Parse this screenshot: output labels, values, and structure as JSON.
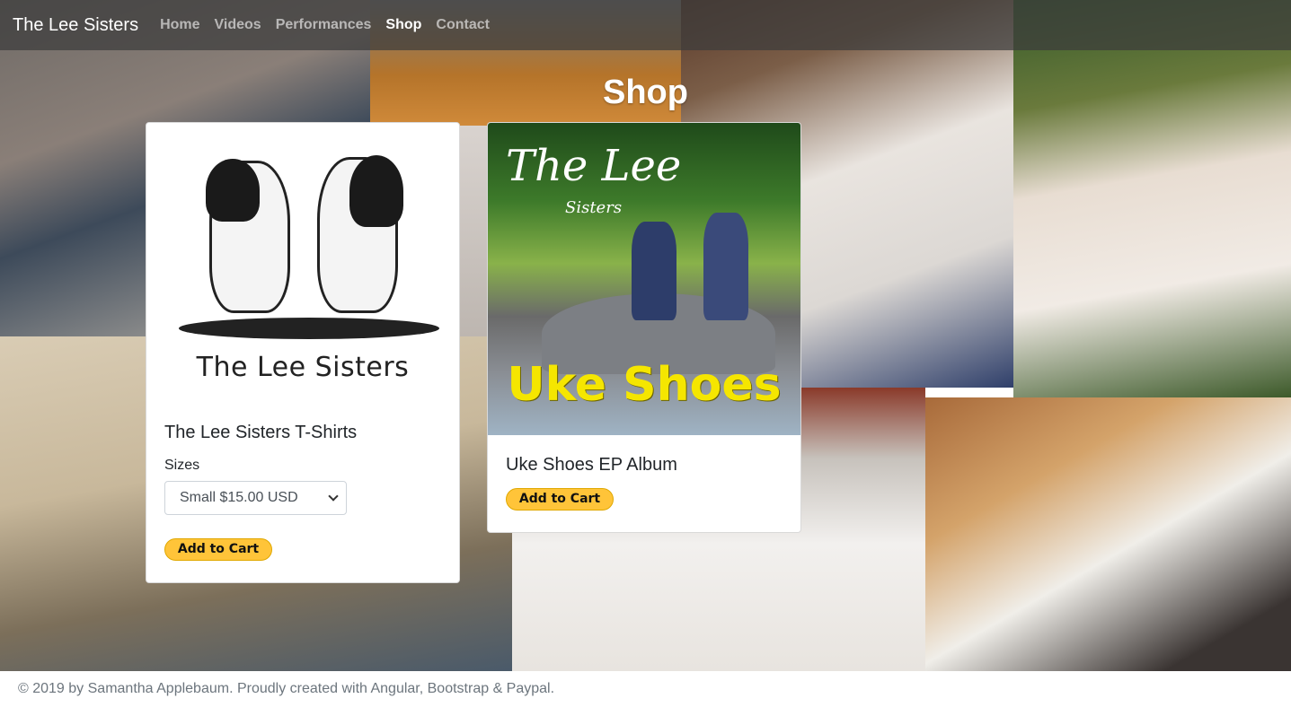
{
  "navbar": {
    "brand": "The Lee Sisters",
    "links": [
      "Home",
      "Videos",
      "Performances",
      "Shop",
      "Contact"
    ],
    "active": "Shop"
  },
  "page": {
    "title": "Shop"
  },
  "products": [
    {
      "image_text": "The Lee Sisters",
      "title": "The Lee Sisters T-Shirts",
      "size_label": "Sizes",
      "size_selected": "Small $15.00 USD",
      "button": "Add to Cart"
    },
    {
      "image_title_big": "The Lee",
      "image_title_small": "Sisters",
      "image_album": "Uke Shoes",
      "title": "Uke Shoes EP Album",
      "button": "Add to Cart"
    }
  ],
  "footer": {
    "text": "© 2019 by Samantha Applebaum. Proudly created with Angular, Bootstrap & Paypal."
  },
  "colors": {
    "paypal_yellow": "#ffc439",
    "navbar_bg": "rgba(60,60,60,0.72)"
  }
}
